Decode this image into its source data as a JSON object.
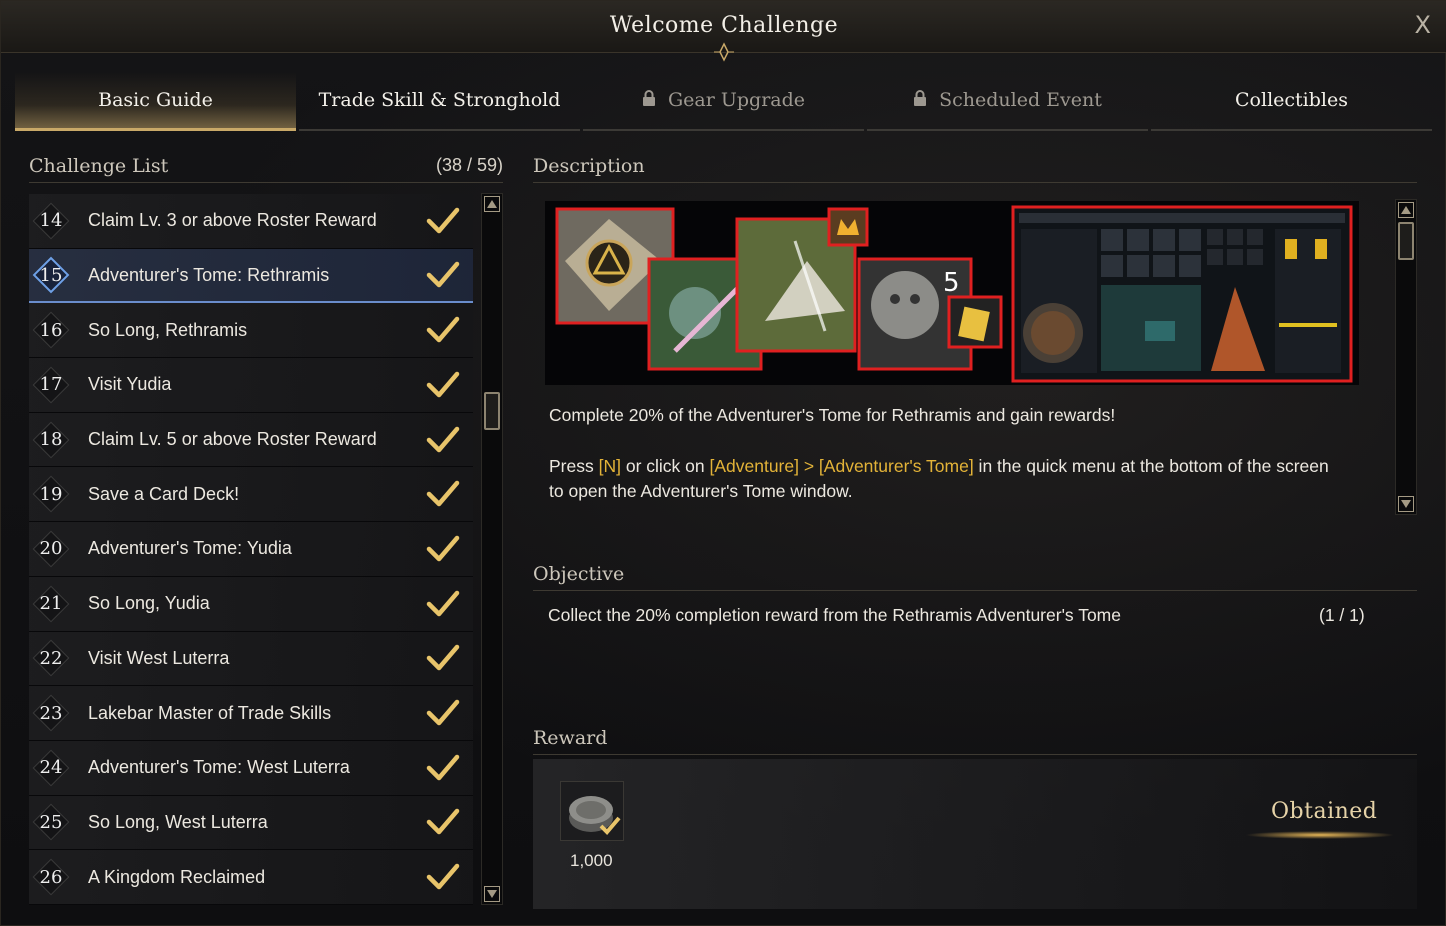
{
  "window": {
    "title": "Welcome Challenge",
    "close_label": "X"
  },
  "tabs": [
    {
      "label": "Basic Guide",
      "active": true,
      "locked": false
    },
    {
      "label": "Trade Skill & Stronghold",
      "active": false,
      "locked": false
    },
    {
      "label": "Gear Upgrade",
      "active": false,
      "locked": true
    },
    {
      "label": "Scheduled Event",
      "active": false,
      "locked": true
    },
    {
      "label": "Collectibles",
      "active": false,
      "locked": false
    }
  ],
  "challenge_list": {
    "heading": "Challenge List",
    "count": "(38 / 59)",
    "items": [
      {
        "num": "14",
        "label": "Claim Lv. 3 or above Roster Reward",
        "done": true
      },
      {
        "num": "15",
        "label": "Adventurer's Tome: Rethramis",
        "done": true,
        "selected": true
      },
      {
        "num": "16",
        "label": "So Long, Rethramis",
        "done": true
      },
      {
        "num": "17",
        "label": "Visit Yudia",
        "done": true
      },
      {
        "num": "18",
        "label": "Claim Lv. 5 or above Roster Reward",
        "done": true
      },
      {
        "num": "19",
        "label": "Save a Card Deck!",
        "done": true
      },
      {
        "num": "20",
        "label": "Adventurer's Tome: Yudia",
        "done": true
      },
      {
        "num": "21",
        "label": "So Long, Yudia",
        "done": true
      },
      {
        "num": "22",
        "label": "Visit West Luterra",
        "done": true
      },
      {
        "num": "23",
        "label": "Lakebar Master of Trade Skills",
        "done": true
      },
      {
        "num": "24",
        "label": "Adventurer's Tome: West Luterra",
        "done": true
      },
      {
        "num": "25",
        "label": "So Long, West Luterra",
        "done": true
      },
      {
        "num": "26",
        "label": "A Kingdom Reclaimed",
        "done": true
      }
    ]
  },
  "description": {
    "heading": "Description",
    "line1": "Complete 20% of the Adventurer's Tome for Rethramis and gain rewards!",
    "press": "Press ",
    "key": "[N]",
    "or_click": " or click on ",
    "menu": "[Adventure] > [Adventurer's Tome]",
    "rest": " in the quick menu at the bottom of the screen",
    "line3": "to open the Adventurer's Tome window.",
    "image_badge": "5"
  },
  "objective": {
    "heading": "Objective",
    "text": "Collect the 20% completion reward from the Rethramis Adventurer's Tome",
    "count": "(1 / 1)"
  },
  "reward": {
    "heading": "Reward",
    "amount": "1,000",
    "icon": "silver-coin-icon",
    "status": "Obtained"
  },
  "colors": {
    "accent_gold": "#c9a968",
    "highlight": "#e3b338",
    "selected_blue": "#6a8dcc",
    "check_gold": "#e8c46a"
  }
}
